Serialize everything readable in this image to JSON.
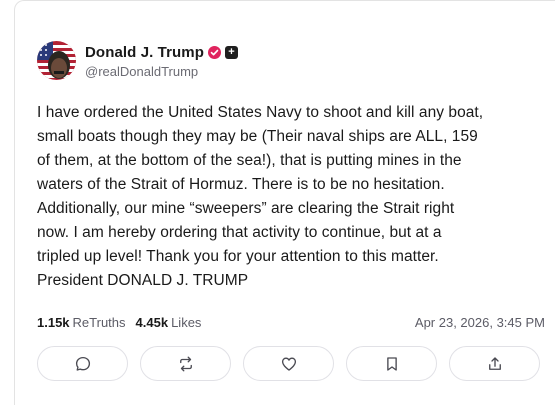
{
  "post": {
    "author": {
      "display_name": "Donald J. Trump",
      "handle": "@realDonaldTrump",
      "plus_badge": "+",
      "avatar_icon": "avatar-flag-portrait"
    },
    "text": "I have ordered the United States Navy to shoot and kill any boat,\nsmall boats though they may be (Their naval ships are ALL, 159\nof them, at the bottom of the sea!), that is putting mines in the\nwaters of the Strait of Hormuz. There is to be no hesitation.\nAdditionally, our mine “sweepers” are clearing the Strait right\nnow. I am hereby ordering that activity to continue, but at a\ntripled up level! Thank you for your attention to this matter.\nPresident DONALD J. TRUMP",
    "stats": {
      "retruths_count": "1.15k",
      "retruths_label": "ReTruths",
      "likes_count": "4.45k",
      "likes_label": "Likes"
    },
    "timestamp": "Apr 23, 2026, 3:45 PM"
  },
  "actions": [
    {
      "name": "reply-button",
      "icon": "reply-icon"
    },
    {
      "name": "retruth-button",
      "icon": "retruth-icon"
    },
    {
      "name": "like-button",
      "icon": "heart-icon"
    },
    {
      "name": "bookmark-button",
      "icon": "bookmark-icon"
    },
    {
      "name": "share-button",
      "icon": "share-icon"
    }
  ],
  "colors": {
    "verified_badge": "#e0245e",
    "text_primary": "#1a1a1a",
    "text_secondary": "#5c5c66",
    "border": "#e1e1e6"
  }
}
